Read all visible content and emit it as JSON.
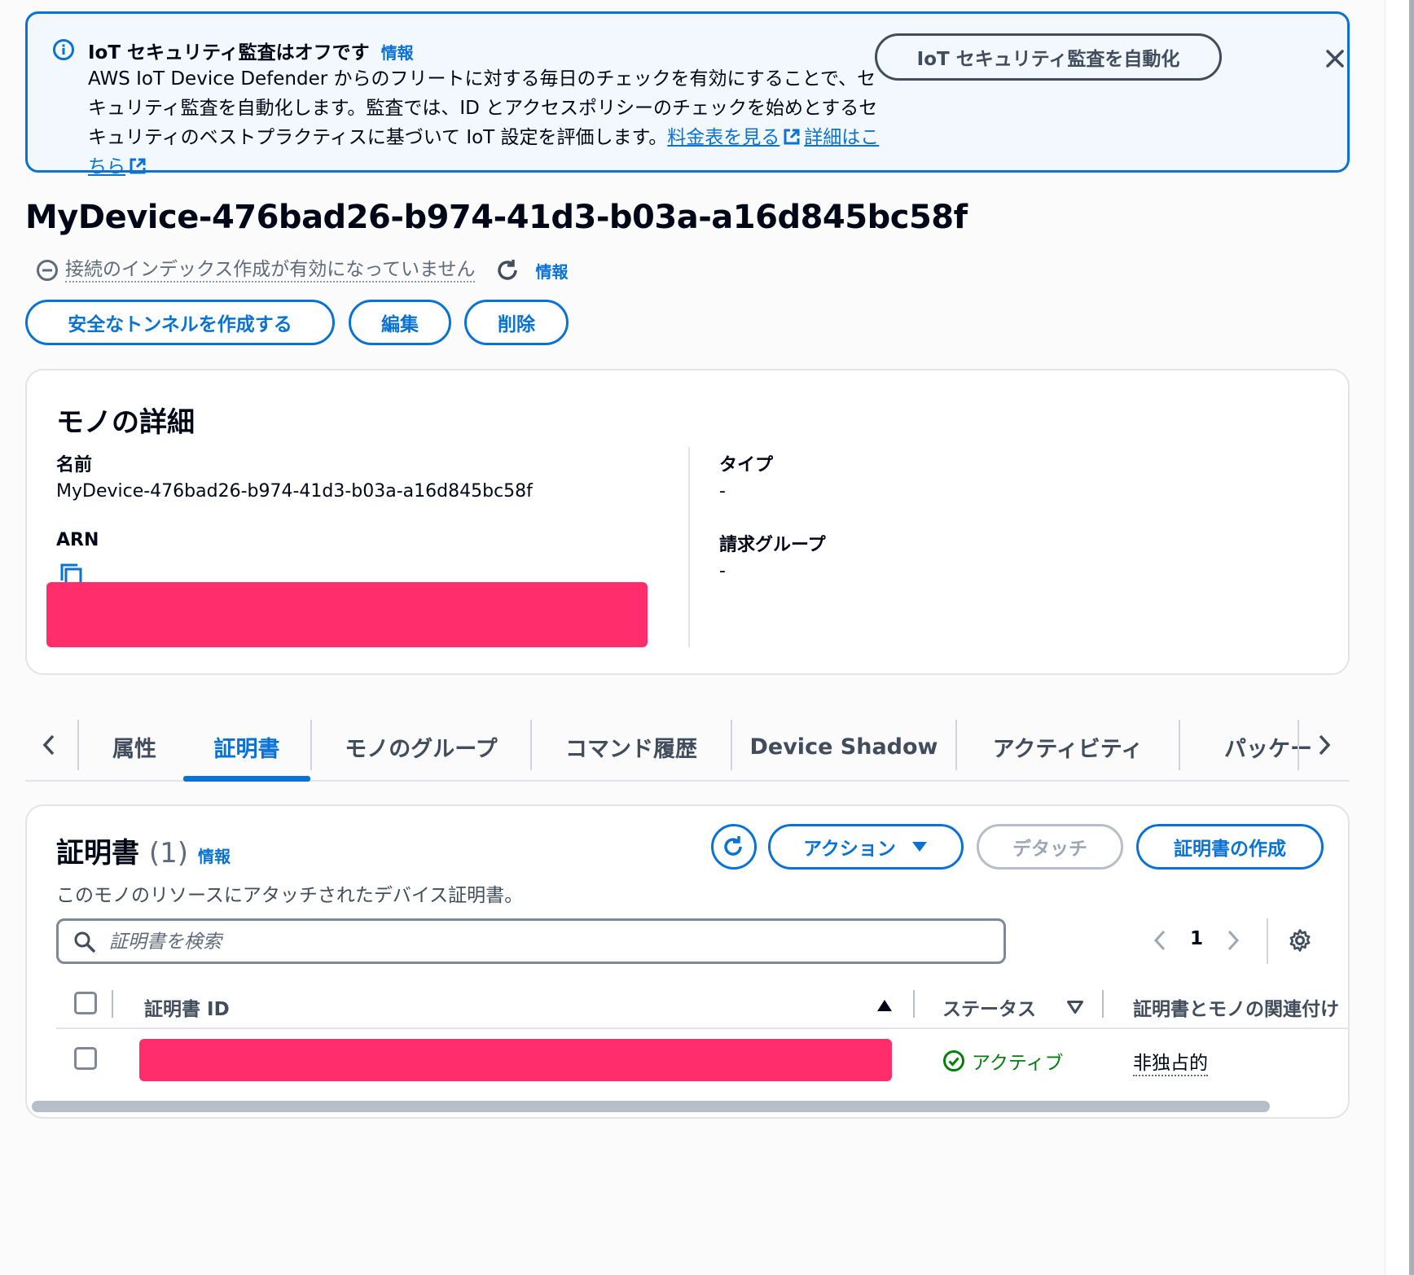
{
  "banner": {
    "title": "IoT セキュリティ監査はオフです",
    "info_link": "情報",
    "body": "AWS IoT Device Defender からのフリートに対する毎日のチェックを有効にすることで、セキュリティ監査を自動化します。監査では、ID とアクセスポリシーのチェックを始めとするセキュリティのベストプラクティスに基づいて IoT 設定を評価します。",
    "pricing_link": "料金表を見る",
    "details_link": "詳細はこちら",
    "automate_button": "IoT セキュリティ監査を自動化"
  },
  "page": {
    "title": "MyDevice-476bad26-b974-41d3-b03a-a16d845bc58f",
    "index_status": "接続のインデックス作成が有効になっていません",
    "info_link": "情報"
  },
  "actions": {
    "tunnel": "安全なトンネルを作成する",
    "edit": "編集",
    "delete": "削除"
  },
  "details": {
    "heading": "モノの詳細",
    "name_label": "名前",
    "name_value": "MyDevice-476bad26-b974-41d3-b03a-a16d845bc58f",
    "arn_label": "ARN",
    "type_label": "タイプ",
    "type_value": "-",
    "billing_label": "請求グループ",
    "billing_value": "-"
  },
  "tabs": [
    {
      "label": "属性"
    },
    {
      "label": "証明書"
    },
    {
      "label": "モノのグループ"
    },
    {
      "label": "コマンド履歴"
    },
    {
      "label": "Device Shadow"
    },
    {
      "label": "アクティビティ"
    },
    {
      "label": "パッケー"
    }
  ],
  "certs": {
    "heading": "証明書",
    "count": "(1)",
    "info_link": "情報",
    "description": "このモノのリソースにアタッチされたデバイス証明書。",
    "actions_button": "アクション",
    "detach_button": "デタッチ",
    "create_button": "証明書の作成",
    "search_placeholder": "証明書を検索",
    "page": "1",
    "columns": [
      "証明書 ID",
      "ステータス",
      "証明書とモノの関連付け"
    ],
    "rows": [
      {
        "status": "アクティブ",
        "association": "非独占的"
      }
    ]
  },
  "colors": {
    "accent": "#0972d3",
    "success": "#037f0c",
    "redaction": "#ff2d6b"
  }
}
